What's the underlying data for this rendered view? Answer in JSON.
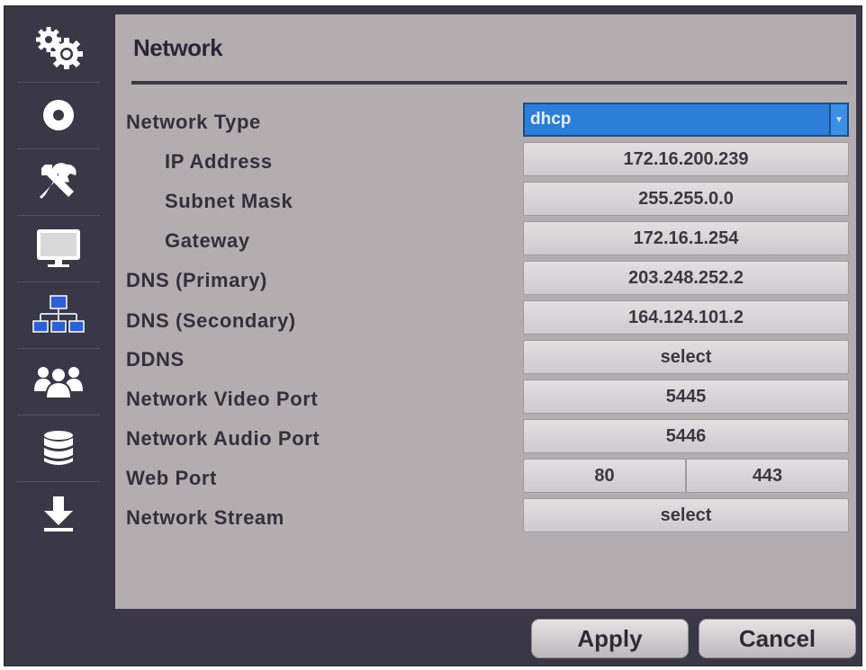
{
  "title": "Network",
  "sidebar": {
    "items": [
      {
        "icon": "gears-icon"
      },
      {
        "icon": "disc-icon"
      },
      {
        "icon": "tools-icon"
      },
      {
        "icon": "monitor-icon"
      },
      {
        "icon": "network-icon",
        "active": true
      },
      {
        "icon": "users-icon"
      },
      {
        "icon": "database-icon"
      },
      {
        "icon": "download-icon"
      }
    ]
  },
  "rows": {
    "network_type": {
      "label": "Network Type",
      "value": "dhcp"
    },
    "ip_address": {
      "label": "IP Address",
      "value": "172.16.200.239"
    },
    "subnet_mask": {
      "label": "Subnet Mask",
      "value": "255.255.0.0"
    },
    "gateway": {
      "label": "Gateway",
      "value": "172.16.1.254"
    },
    "dns_primary": {
      "label": "DNS (Primary)",
      "value": "203.248.252.2"
    },
    "dns_secondary": {
      "label": "DNS (Secondary)",
      "value": "164.124.101.2"
    },
    "ddns": {
      "label": "DDNS",
      "value": "select"
    },
    "video_port": {
      "label": "Network Video Port",
      "value": "5445"
    },
    "audio_port": {
      "label": "Network Audio Port",
      "value": "5446"
    },
    "web_port": {
      "label": "Web Port",
      "http": "80",
      "https": "443"
    },
    "stream": {
      "label": "Network Stream",
      "value": "select"
    }
  },
  "buttons": {
    "apply": "Apply",
    "cancel": "Cancel"
  },
  "colors": {
    "frame": "#3a3746",
    "panel": "#b3adb0",
    "dropdown": "#2c7ed8",
    "network_icon": "#2d5fd6"
  }
}
